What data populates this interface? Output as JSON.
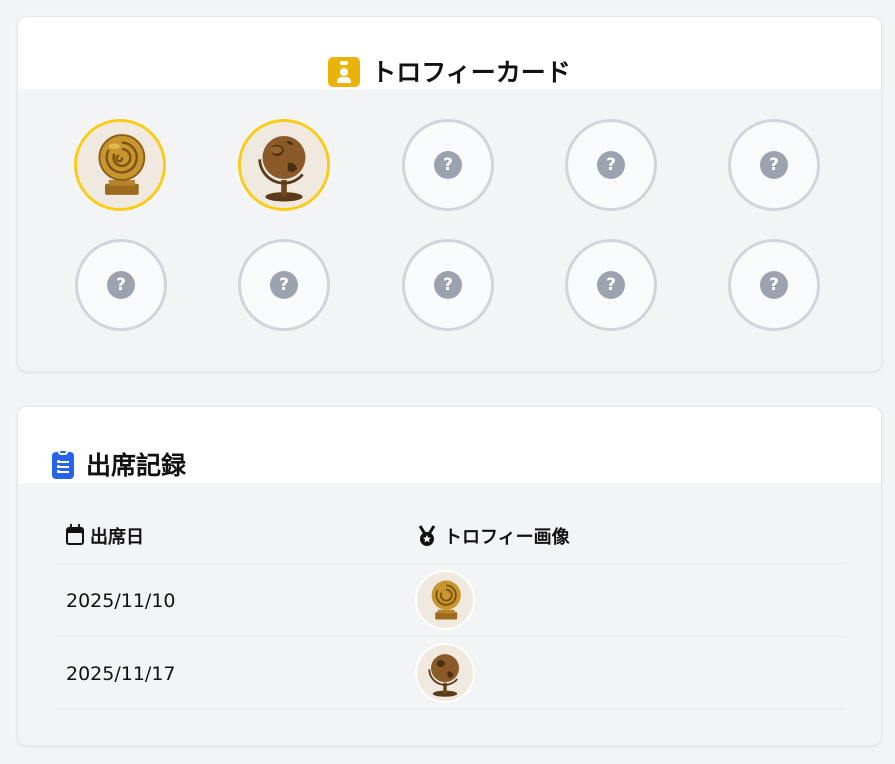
{
  "trophy_card": {
    "title": "トロフィーカード",
    "icon": "id-badge-icon",
    "accent": "#eab308",
    "earned_border": "#facc15",
    "locked_border": "#d1d5db",
    "slots": [
      {
        "state": "earned",
        "trophy": "ammonite-trophy"
      },
      {
        "state": "earned",
        "trophy": "globe-trophy"
      },
      {
        "state": "locked",
        "label": "?"
      },
      {
        "state": "locked",
        "label": "?"
      },
      {
        "state": "locked",
        "label": "?"
      },
      {
        "state": "locked",
        "label": "?"
      },
      {
        "state": "locked",
        "label": "?"
      },
      {
        "state": "locked",
        "label": "?"
      },
      {
        "state": "locked",
        "label": "?"
      },
      {
        "state": "locked",
        "label": "?"
      }
    ]
  },
  "attendance": {
    "title": "出席記録",
    "icon": "clipboard-list-icon",
    "accent": "#2563eb",
    "columns": {
      "date": "出席日",
      "date_icon": "calendar-icon",
      "image": "トロフィー画像",
      "image_icon": "medal-icon"
    },
    "rows": [
      {
        "date": "2025/11/10",
        "trophy": "ammonite-trophy"
      },
      {
        "date": "2025/11/17",
        "trophy": "globe-trophy"
      }
    ]
  }
}
